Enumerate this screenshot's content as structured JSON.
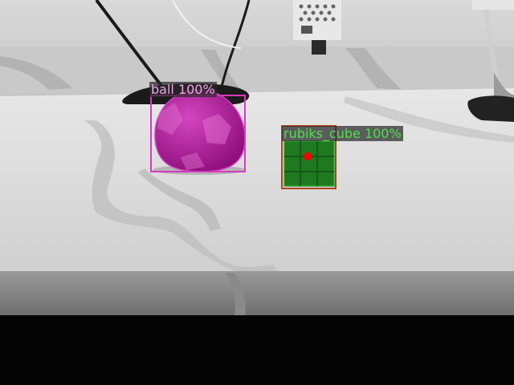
{
  "detections": [
    {
      "label": "ball",
      "score": "100%",
      "text": "ball 100%",
      "color": "#d43bc0"
    },
    {
      "label": "rubiks_cube",
      "score": "100%",
      "text": "rubiks_cube 100%",
      "color": "#2fa52f"
    }
  ],
  "colors": {
    "ball_mask": "#b0129a",
    "cube_mask": "#1f7a1f",
    "cube_center_point": "#ff0000"
  }
}
